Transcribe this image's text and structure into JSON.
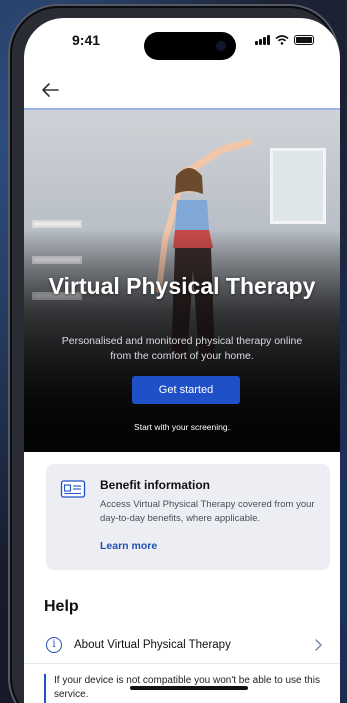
{
  "status_bar": {
    "time": "9:41"
  },
  "nav": {
    "back_icon": "arrow-left-icon"
  },
  "hero": {
    "title": "Virtual Physical Therapy",
    "subtitle": "Personalised and monitored physical therapy online from the comfort of your home.",
    "cta_label": "Get started",
    "note": "Start with your screening."
  },
  "benefit": {
    "icon": "id-card-icon",
    "title": "Benefit information",
    "body": "Access Virtual Physical Therapy covered from your day-to-day benefits, where applicable.",
    "link_label": "Learn more"
  },
  "help": {
    "title": "Help",
    "items": [
      {
        "icon": "info-icon",
        "label": "About Virtual Physical Therapy"
      }
    ]
  },
  "notice": {
    "text": "If your device is not compatible you won't be able to use this service."
  },
  "colors": {
    "accent": "#2050c8",
    "link": "#1f4fb0",
    "card_bg": "#eceef3"
  }
}
